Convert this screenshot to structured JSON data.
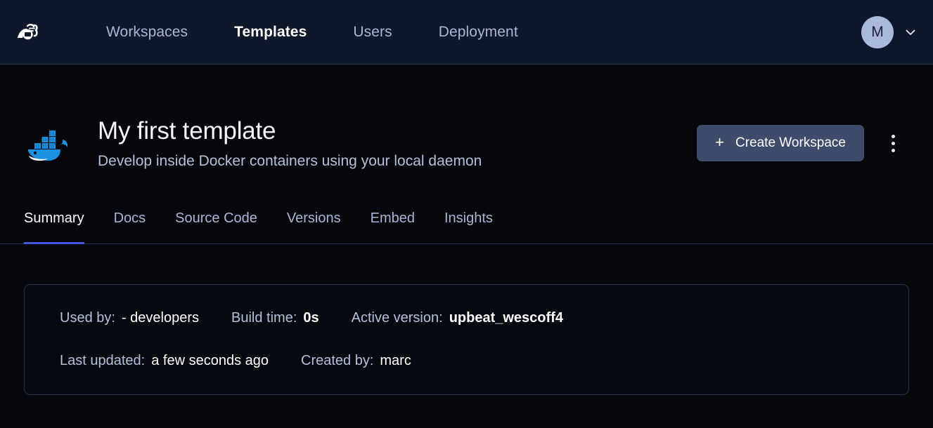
{
  "nav": {
    "logo": "coder-logo",
    "links": [
      {
        "label": "Workspaces",
        "active": false
      },
      {
        "label": "Templates",
        "active": true
      },
      {
        "label": "Users",
        "active": false
      },
      {
        "label": "Deployment",
        "active": false
      }
    ],
    "avatar_initial": "M",
    "chevron": "chevron-down-icon"
  },
  "hero": {
    "icon": "docker-whale-icon",
    "title": "My first template",
    "description": "Develop inside Docker containers using your local daemon",
    "create_button": {
      "plus": "+",
      "label": "Create Workspace"
    },
    "kebab": "more-options-icon"
  },
  "tabs": [
    {
      "label": "Summary",
      "active": true
    },
    {
      "label": "Docs",
      "active": false
    },
    {
      "label": "Source Code",
      "active": false
    },
    {
      "label": "Versions",
      "active": false
    },
    {
      "label": "Embed",
      "active": false
    },
    {
      "label": "Insights",
      "active": false
    }
  ],
  "info": {
    "row1": [
      {
        "label": "Used by:",
        "value": "- developers",
        "bold": false
      },
      {
        "label": "Build time:",
        "value": "0s",
        "bold": true
      },
      {
        "label": "Active version:",
        "value": "upbeat_wescoff4",
        "bold": true
      }
    ],
    "row2": [
      {
        "label": "Last updated:",
        "value": "a few seconds ago",
        "bold": false
      },
      {
        "label": "Created by:",
        "value": "marc",
        "bold": false
      }
    ]
  },
  "colors": {
    "page_bg": "#05070d",
    "header_bg": "#0f172a",
    "border": "#26324a",
    "accent": "#4656dd",
    "muted_text": "#aab7d4",
    "primary_button": "#3e4b6b",
    "avatar_bg": "#a9b9d9",
    "docker_blue": "#1d91e0"
  }
}
